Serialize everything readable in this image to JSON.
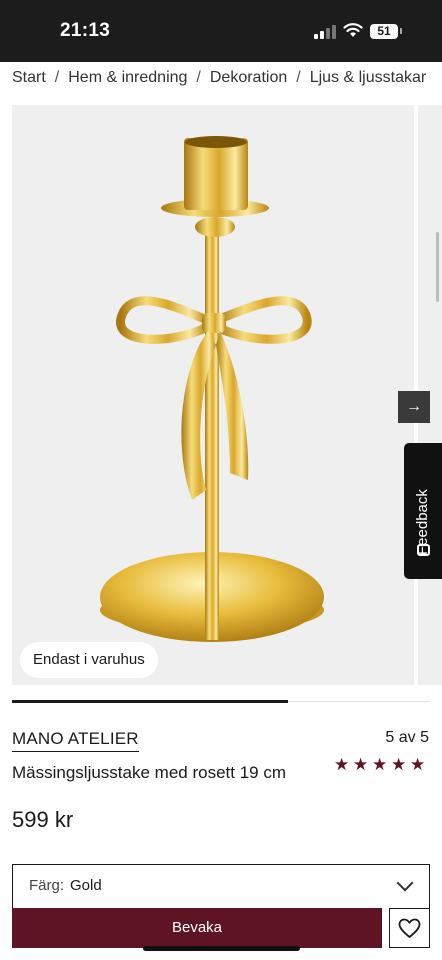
{
  "status_bar": {
    "time": "21:13",
    "battery": "51"
  },
  "breadcrumb": [
    "Start",
    "Hem & inredning",
    "Dekoration",
    "Ljus & ljusstakar"
  ],
  "gallery": {
    "badge": "Endast i varuhus",
    "image_subject": "brass candlestick with bow",
    "progress": 0.66
  },
  "feedback": {
    "label": "Feedback",
    "icon": "smiley-icon"
  },
  "product": {
    "brand": "MANO ATELIER",
    "rating_text": "5 av 5",
    "rating": 5,
    "name": "Mässingsljusstake med rosett 19 cm",
    "price": "599 kr"
  },
  "color_select": {
    "label": "Färg:",
    "value": "Gold"
  },
  "actions": {
    "watch_label": "Bevaka",
    "wishlist_icon": "heart-icon"
  },
  "colors": {
    "accent": "#5e1422",
    "status_bar": "#1c1c1c",
    "image_bg": "#efefef"
  }
}
